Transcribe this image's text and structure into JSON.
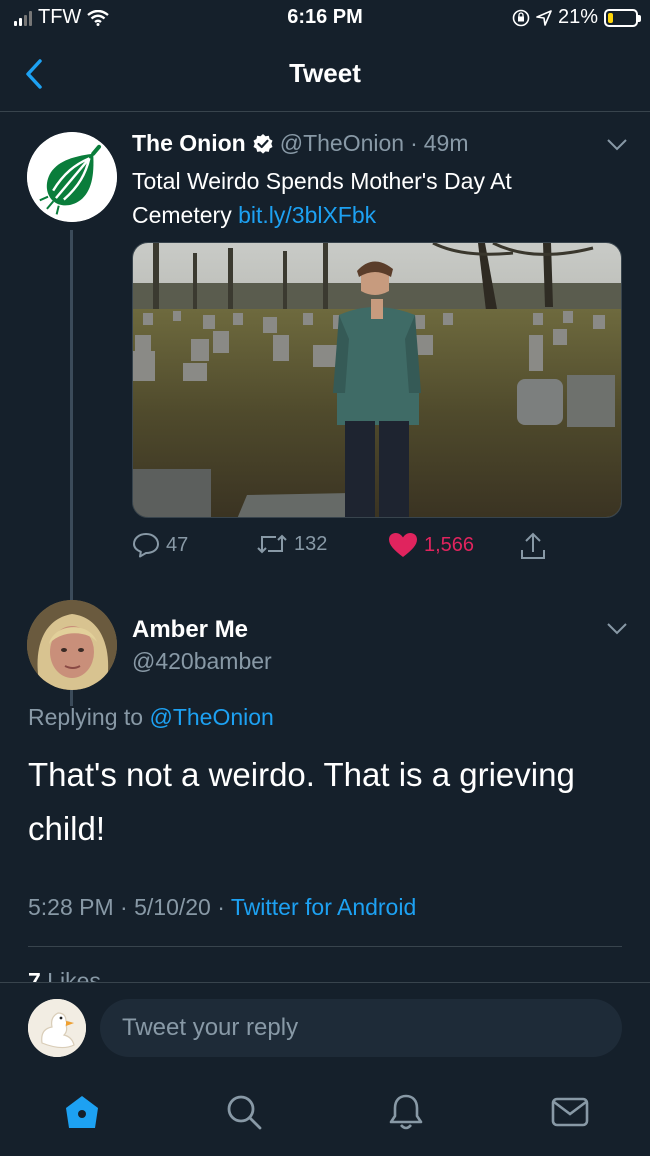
{
  "status_bar": {
    "carrier": "TFW",
    "time": "6:16 PM",
    "battery": "21%",
    "battery_level": 0.21
  },
  "header": {
    "title": "Tweet",
    "back_icon": "chevron-left-icon"
  },
  "quoted_tweet": {
    "author_name": "The Onion",
    "handle": "@TheOnion",
    "separator": "·",
    "age": "49m",
    "text": "Total Weirdo Spends Mother's Day At Cemetery ",
    "link": "bit.ly/3blXFbk",
    "actions": {
      "replies": "47",
      "retweets": "132",
      "likes": "1,566"
    }
  },
  "reply_tweet": {
    "author_name": "Amber Me",
    "handle": "@420bamber",
    "replying_prefix": "Replying to ",
    "replying_handle": "@TheOnion",
    "text": "That's not a weirdo. That is a grieving child!",
    "time": "5:28 PM",
    "date": "5/10/20",
    "separator": " · ",
    "source": "Twitter for Android",
    "likes_number": "7",
    "likes_label": " Likes"
  },
  "composer": {
    "placeholder": "Tweet your reply"
  },
  "tabs": [
    {
      "icon": "home-icon",
      "active": true
    },
    {
      "icon": "search-icon",
      "active": false
    },
    {
      "icon": "bell-icon",
      "active": false
    },
    {
      "icon": "mail-icon",
      "active": false
    }
  ],
  "colors": {
    "background": "#15202b",
    "accent": "#1da1f2",
    "like": "#e0245e",
    "muted": "#8899a6",
    "onion_green": "#0a7d3b"
  }
}
